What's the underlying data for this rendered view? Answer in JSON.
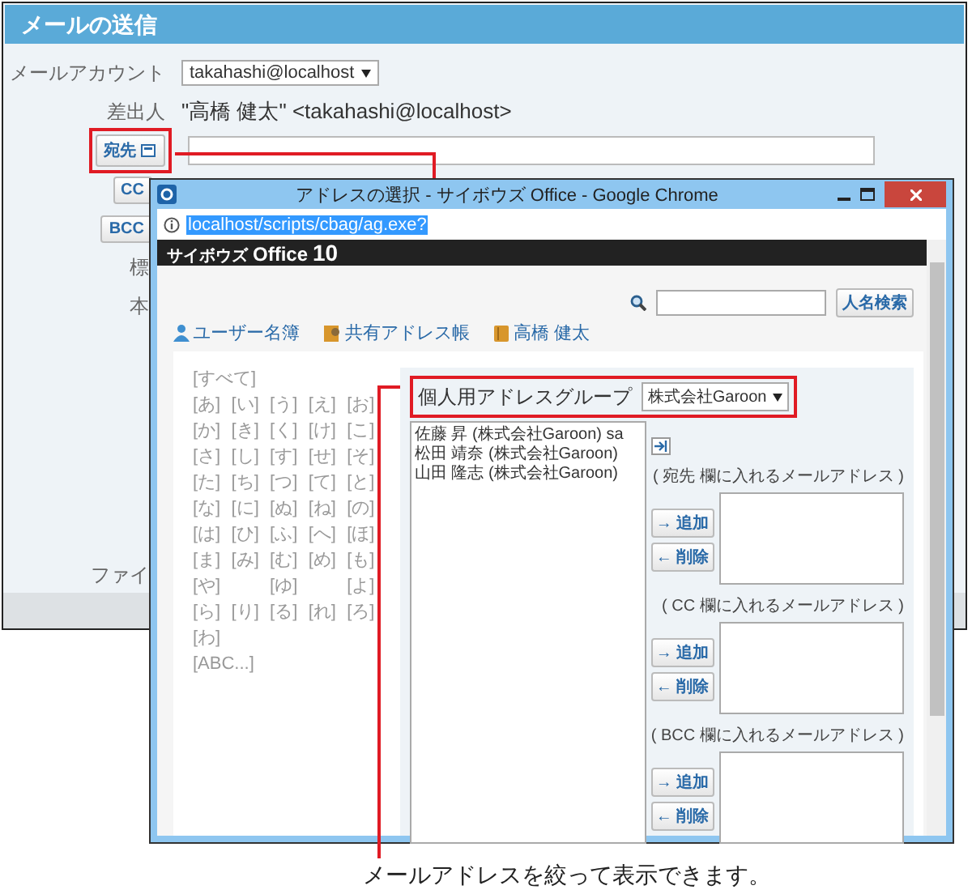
{
  "main_window": {
    "title": "メールの送信",
    "account": {
      "label": "メールアカウント",
      "value": "takahashi@localhost"
    },
    "sender": {
      "label": "差出人",
      "value": "\"高橋 健太\" <takahashi@localhost>"
    },
    "to_button": {
      "label": "宛先",
      "highlighted": true
    },
    "field_buttons": [
      "CC",
      "BCC"
    ],
    "labels": [
      "標",
      "本"
    ],
    "file_label": "ファイ"
  },
  "popup": {
    "title": "アドレスの選択 - サイボウズ Office - Google Chrome",
    "url": "localhost/scripts/cbag/ag.exe?",
    "logo": {
      "brand": "サイボウズ",
      "product": "Office",
      "version": "10"
    },
    "search_button": "人名検索",
    "tabs": [
      {
        "label": "ユーザー名簿",
        "kind": "user"
      },
      {
        "label": "共有アドレス帳",
        "kind": "shared"
      },
      {
        "label": "高橋 健太",
        "kind": "personal"
      }
    ],
    "kana_index": [
      {
        "kind": "full",
        "items": [
          "[すべて]"
        ]
      },
      {
        "kind": "row",
        "items": [
          "[あ]",
          "[い]",
          "[う]",
          "[え]",
          "[お]"
        ]
      },
      {
        "kind": "row",
        "items": [
          "[か]",
          "[き]",
          "[く]",
          "[け]",
          "[こ]"
        ]
      },
      {
        "kind": "row",
        "items": [
          "[さ]",
          "[し]",
          "[す]",
          "[せ]",
          "[そ]"
        ]
      },
      {
        "kind": "row",
        "items": [
          "[た]",
          "[ち]",
          "[つ]",
          "[て]",
          "[と]"
        ]
      },
      {
        "kind": "row",
        "items": [
          "[な]",
          "[に]",
          "[ぬ]",
          "[ね]",
          "[の]"
        ]
      },
      {
        "kind": "row",
        "items": [
          "[は]",
          "[ひ]",
          "[ふ]",
          "[へ]",
          "[ほ]"
        ]
      },
      {
        "kind": "row",
        "items": [
          "[ま]",
          "[み]",
          "[む]",
          "[め]",
          "[も]"
        ]
      },
      {
        "kind": "spaced",
        "items": [
          "[や]",
          "[ゆ]",
          "[よ]"
        ]
      },
      {
        "kind": "row",
        "items": [
          "[ら]",
          "[り]",
          "[る]",
          "[れ]",
          "[ろ]"
        ]
      },
      {
        "kind": "row",
        "items": [
          "[わ]"
        ]
      },
      {
        "kind": "full",
        "items": [
          "[ABC...]"
        ]
      }
    ],
    "group": {
      "label": "個人用アドレスグループ",
      "value": "株式会社Garoon",
      "highlighted": true
    },
    "addresses": [
      "佐藤 昇 (株式会社Garoon) sa",
      "松田 靖奈 (株式会社Garoon)",
      "山田 隆志 (株式会社Garoon)"
    ],
    "sections": [
      {
        "label": "( 宛先 欄に入れるメールアドレス )",
        "add": "→ 追加",
        "remove": "← 削除"
      },
      {
        "label": "( CC 欄に入れるメールアドレス )",
        "add": "→ 追加",
        "remove": "← 削除"
      },
      {
        "label": "( BCC 欄に入れるメールアドレス )",
        "add": "→ 追加",
        "remove": "← 削除"
      }
    ]
  },
  "callout": "メールアドレスを絞って表示できます。"
}
